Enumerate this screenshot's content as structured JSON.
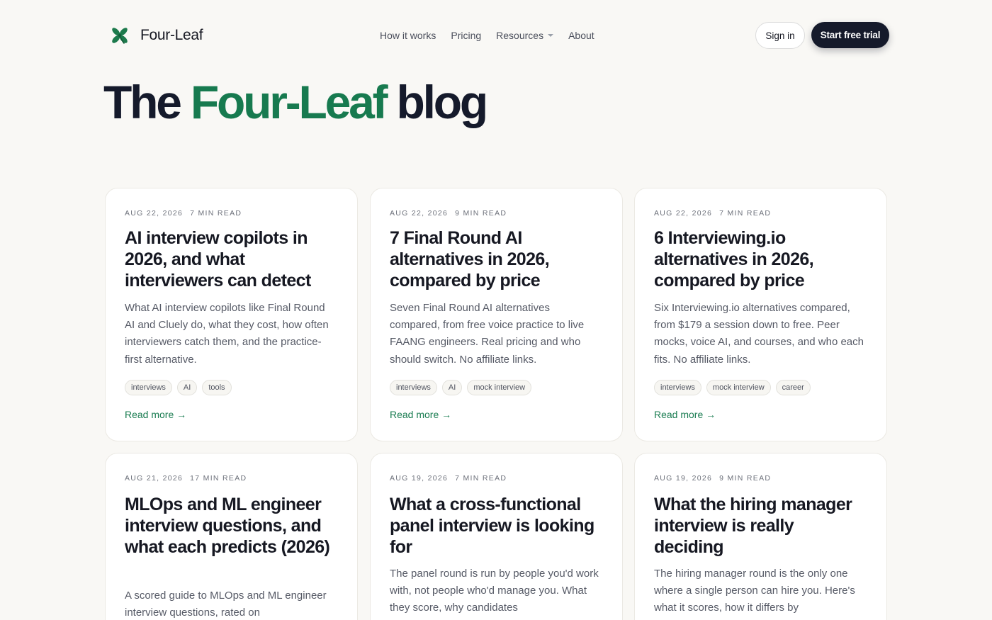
{
  "header": {
    "brand": "Four-Leaf",
    "nav": [
      {
        "label": "How it works"
      },
      {
        "label": "Pricing"
      },
      {
        "label": "Resources",
        "dropdown": true
      },
      {
        "label": "About"
      }
    ],
    "signin_label": "Sign in",
    "trial_label": "Start free trial"
  },
  "hero": {
    "title_prefix": "The",
    "title_accent": "Four-Leaf",
    "title_suffix": "blog"
  },
  "colors": {
    "accent_green": "#177a4f",
    "dark": "#151a2b",
    "background": "#f9f8f5"
  },
  "posts": [
    {
      "date": "AUG 22, 2026",
      "read_time": "7 MIN READ",
      "title": "AI interview copilots in 2026, and what interviewers can detect",
      "excerpt": "What AI interview copilots like Final Round AI and Cluely do, what they cost, how often interviewers catch them, and the practice-first alternative.",
      "tags": [
        "interviews",
        "AI",
        "tools"
      ],
      "cta": "Read more →"
    },
    {
      "date": "AUG 22, 2026",
      "read_time": "9 MIN READ",
      "title": "7 Final Round AI alternatives in 2026, compared by price",
      "excerpt": "Seven Final Round AI alternatives compared, from free voice practice to live FAANG engineers. Real pricing and who should switch. No affiliate links.",
      "tags": [
        "interviews",
        "AI",
        "mock interview"
      ],
      "cta": "Read more →"
    },
    {
      "date": "AUG 22, 2026",
      "read_time": "7 MIN READ",
      "title": "6 Interviewing.io alternatives in 2026, compared by price",
      "excerpt": "Six Interviewing.io alternatives compared, from $179 a session down to free. Peer mocks, voice AI, and courses, and who each fits. No affiliate links.",
      "tags": [
        "interviews",
        "mock interview",
        "career"
      ],
      "cta": "Read more →"
    },
    {
      "date": "AUG 21, 2026",
      "read_time": "17 MIN READ",
      "title": "MLOps and ML engineer interview questions, and what each predicts (2026)",
      "excerpt": "A scored guide to MLOps and ML engineer interview questions, rated on",
      "tags": [],
      "cta": ""
    },
    {
      "date": "AUG 19, 2026",
      "read_time": "7 MIN READ",
      "title": "What a cross-functional panel interview is looking for",
      "excerpt": "The panel round is run by people you'd work with, not people who'd manage you. What they score, why candidates",
      "tags": [],
      "cta": ""
    },
    {
      "date": "AUG 19, 2026",
      "read_time": "9 MIN READ",
      "title": "What the hiring manager interview is really deciding",
      "excerpt": "The hiring manager round is the only one where a single person can hire you. Here's what it scores, how it differs by",
      "tags": [],
      "cta": ""
    }
  ]
}
